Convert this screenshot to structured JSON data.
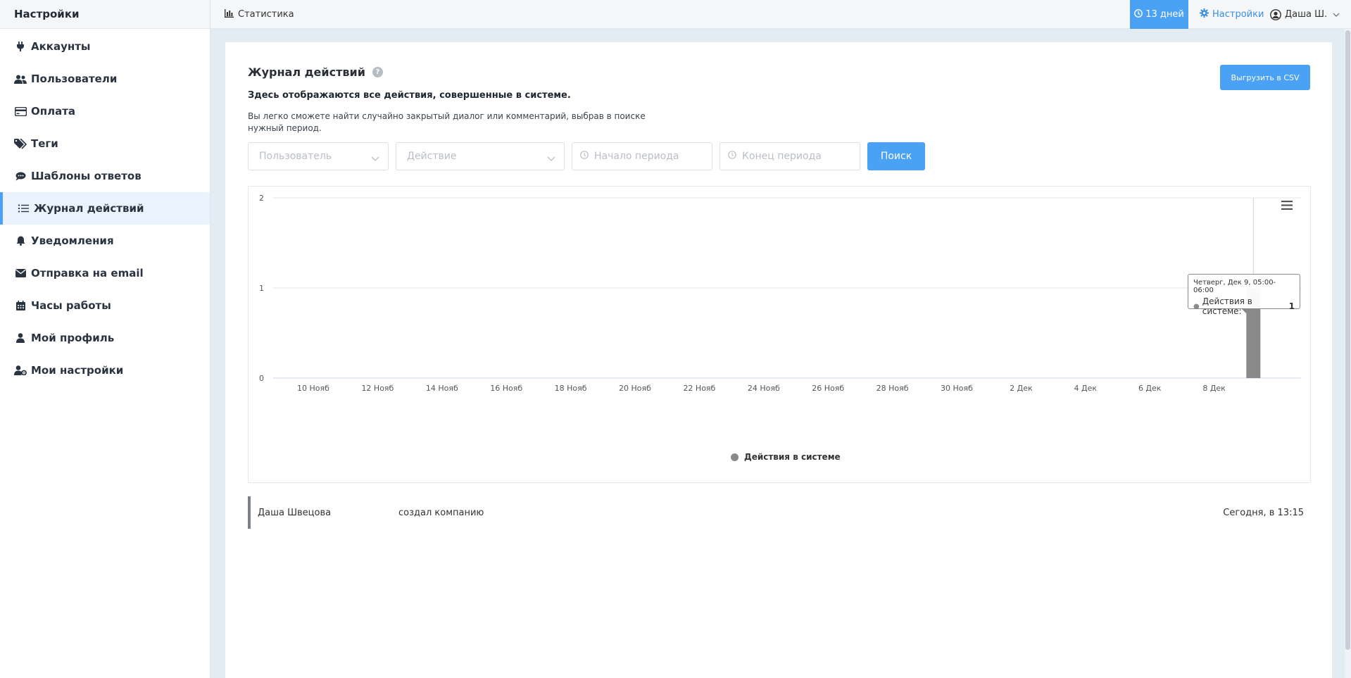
{
  "sidebar": {
    "title": "Настройки",
    "items": [
      {
        "label": "Аккаунты",
        "icon": "plug-icon"
      },
      {
        "label": "Пользователи",
        "icon": "users-icon"
      },
      {
        "label": "Оплата",
        "icon": "credit-card-icon"
      },
      {
        "label": "Теги",
        "icon": "tags-icon"
      },
      {
        "label": "Шаблоны ответов",
        "icon": "comments-icon"
      },
      {
        "label": "Журнал действий",
        "icon": "list-icon",
        "active": true
      },
      {
        "label": "Уведомления",
        "icon": "bell-icon"
      },
      {
        "label": "Отправка на email",
        "icon": "envelope-icon"
      },
      {
        "label": "Часы работы",
        "icon": "calendar-icon"
      },
      {
        "label": "Мой профиль",
        "icon": "user-icon"
      },
      {
        "label": "Мои настройки",
        "icon": "user-cog-icon"
      }
    ]
  },
  "topbar": {
    "stats_label": "Статистика",
    "days_label": "13 дней",
    "settings_label": "Настройки",
    "user_label": "Даша Ш."
  },
  "page": {
    "title": "Журнал действий",
    "help": "?",
    "subtitle": "Здесь отображаются все действия, совершенные в системе.",
    "description": "Вы легко сможете найти случайно закрытый диалог или комментарий, выбрав в поиске нужный период.",
    "csv_button": "Выгрузить в CSV"
  },
  "filters": {
    "user_placeholder": "Пользователь",
    "action_placeholder": "Действие",
    "start_placeholder": "Начало периода",
    "end_placeholder": "Конец периода",
    "search_button": "Поиск"
  },
  "chart_data": {
    "type": "bar",
    "categories": [
      "10 Нояб",
      "12 Нояб",
      "14 Нояб",
      "16 Нояб",
      "18 Нояб",
      "20 Нояб",
      "22 Нояб",
      "24 Нояб",
      "26 Нояб",
      "28 Нояб",
      "30 Нояб",
      "2 Дек",
      "4 Дек",
      "6 Дек",
      "8 Дек"
    ],
    "yticks": [
      0,
      1,
      2
    ],
    "ylim": [
      0,
      2
    ],
    "series": [
      {
        "name": "Действия в системе",
        "values": [
          {
            "x": "Дек 9",
            "y": 1
          }
        ]
      }
    ],
    "legend": "bottom-center",
    "grid": true,
    "bar_color": "#8a8a8a",
    "tooltip": {
      "header": "Четверг, Дек 9, 05:00-06:00",
      "series_label": "Действия в системе:",
      "value": "1"
    }
  },
  "log": [
    {
      "user": "Даша Швецова",
      "action": "создал компанию",
      "time": "Сегодня, в 13:15"
    }
  ],
  "colors": {
    "accent": "#4ba2f5",
    "bar": "#8a8a8a"
  }
}
